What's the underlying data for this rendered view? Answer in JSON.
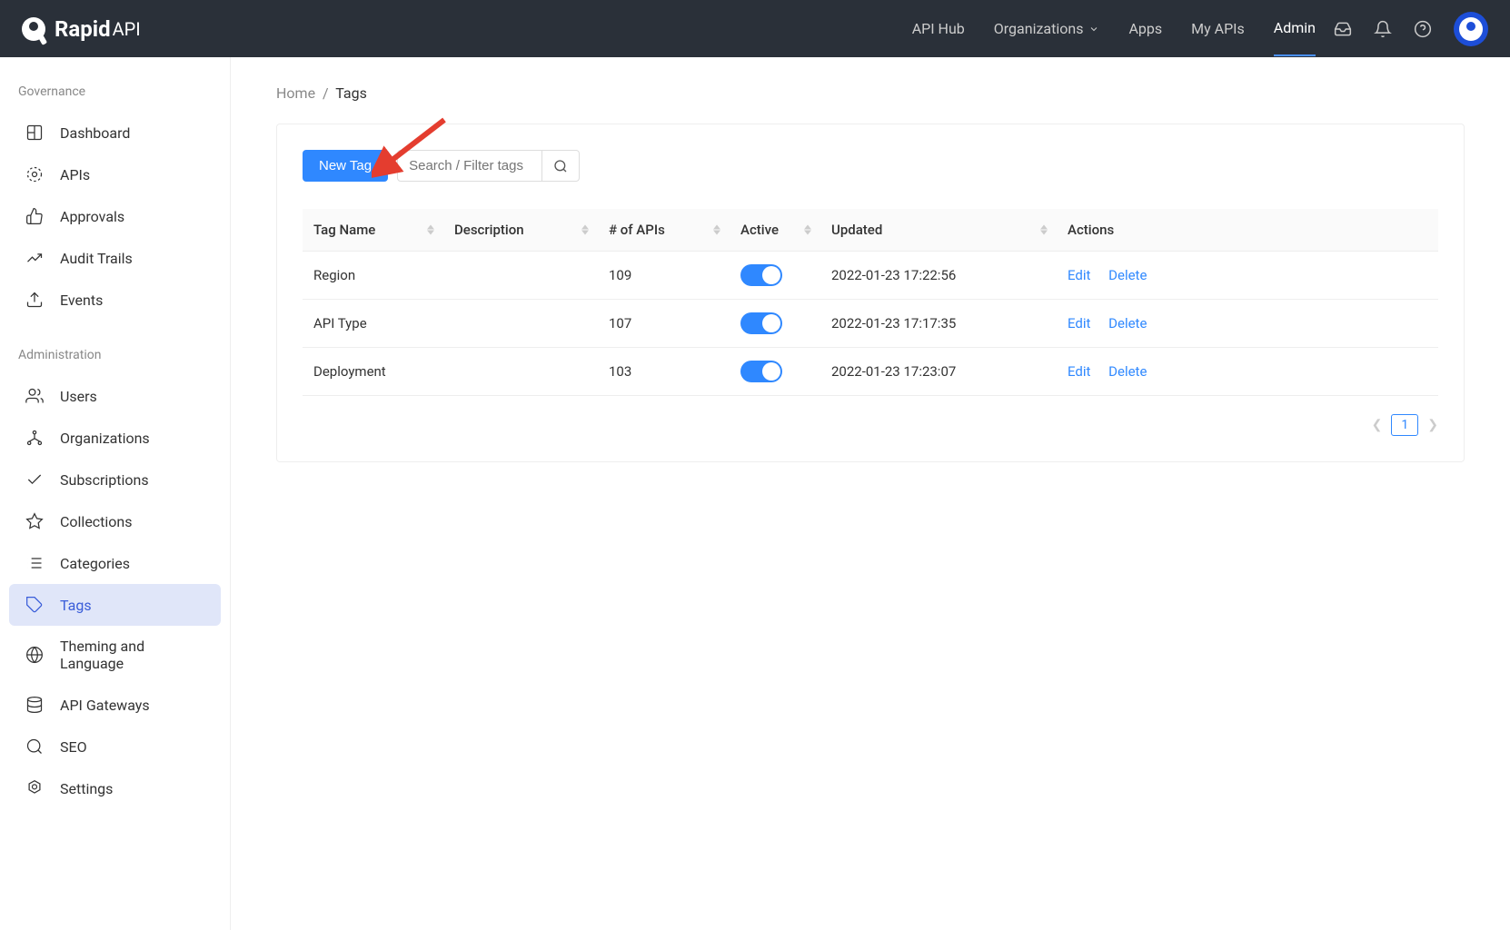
{
  "logo": {
    "brand": "Rapid",
    "suffix": "API"
  },
  "nav": {
    "api_hub": "API Hub",
    "organizations": "Organizations",
    "apps": "Apps",
    "my_apis": "My APIs",
    "admin": "Admin"
  },
  "sidebar": {
    "sections": {
      "governance": {
        "title": "Governance",
        "items": {
          "dashboard": "Dashboard",
          "apis": "APIs",
          "approvals": "Approvals",
          "audit_trails": "Audit Trails",
          "events": "Events"
        }
      },
      "administration": {
        "title": "Administration",
        "items": {
          "users": "Users",
          "organizations": "Organizations",
          "subscriptions": "Subscriptions",
          "collections": "Collections",
          "categories": "Categories",
          "tags": "Tags",
          "theming": "Theming and Language",
          "api_gateways": "API Gateways",
          "seo": "SEO",
          "settings": "Settings"
        }
      }
    }
  },
  "breadcrumb": {
    "home": "Home",
    "sep": "/",
    "current": "Tags"
  },
  "toolbar": {
    "new_tag": "New Tag",
    "search_placeholder": "Search / Filter tags"
  },
  "table": {
    "headers": {
      "tag_name": "Tag Name",
      "description": "Description",
      "num_apis": "# of APIs",
      "active": "Active",
      "updated": "Updated",
      "actions": "Actions"
    },
    "actions": {
      "edit": "Edit",
      "delete": "Delete"
    },
    "rows": [
      {
        "name": "Region",
        "description": "",
        "apis": "109",
        "updated": "2022-01-23 17:22:56"
      },
      {
        "name": "API Type",
        "description": "",
        "apis": "107",
        "updated": "2022-01-23 17:17:35"
      },
      {
        "name": "Deployment",
        "description": "",
        "apis": "103",
        "updated": "2022-01-23 17:23:07"
      }
    ]
  },
  "pagination": {
    "page": "1"
  }
}
